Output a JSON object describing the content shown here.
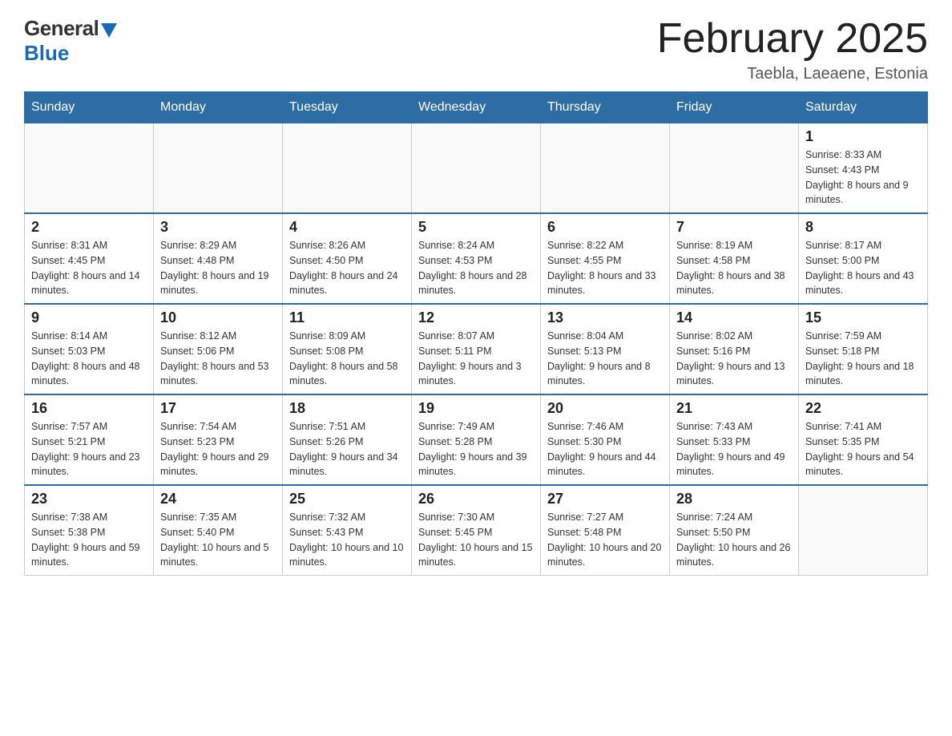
{
  "header": {
    "logo_general": "General",
    "logo_blue": "Blue",
    "month_title": "February 2025",
    "location": "Taebla, Laeaene, Estonia"
  },
  "weekdays": [
    "Sunday",
    "Monday",
    "Tuesday",
    "Wednesday",
    "Thursday",
    "Friday",
    "Saturday"
  ],
  "weeks": [
    [
      {
        "day": "",
        "info": ""
      },
      {
        "day": "",
        "info": ""
      },
      {
        "day": "",
        "info": ""
      },
      {
        "day": "",
        "info": ""
      },
      {
        "day": "",
        "info": ""
      },
      {
        "day": "",
        "info": ""
      },
      {
        "day": "1",
        "info": "Sunrise: 8:33 AM\nSunset: 4:43 PM\nDaylight: 8 hours and 9 minutes."
      }
    ],
    [
      {
        "day": "2",
        "info": "Sunrise: 8:31 AM\nSunset: 4:45 PM\nDaylight: 8 hours and 14 minutes."
      },
      {
        "day": "3",
        "info": "Sunrise: 8:29 AM\nSunset: 4:48 PM\nDaylight: 8 hours and 19 minutes."
      },
      {
        "day": "4",
        "info": "Sunrise: 8:26 AM\nSunset: 4:50 PM\nDaylight: 8 hours and 24 minutes."
      },
      {
        "day": "5",
        "info": "Sunrise: 8:24 AM\nSunset: 4:53 PM\nDaylight: 8 hours and 28 minutes."
      },
      {
        "day": "6",
        "info": "Sunrise: 8:22 AM\nSunset: 4:55 PM\nDaylight: 8 hours and 33 minutes."
      },
      {
        "day": "7",
        "info": "Sunrise: 8:19 AM\nSunset: 4:58 PM\nDaylight: 8 hours and 38 minutes."
      },
      {
        "day": "8",
        "info": "Sunrise: 8:17 AM\nSunset: 5:00 PM\nDaylight: 8 hours and 43 minutes."
      }
    ],
    [
      {
        "day": "9",
        "info": "Sunrise: 8:14 AM\nSunset: 5:03 PM\nDaylight: 8 hours and 48 minutes."
      },
      {
        "day": "10",
        "info": "Sunrise: 8:12 AM\nSunset: 5:06 PM\nDaylight: 8 hours and 53 minutes."
      },
      {
        "day": "11",
        "info": "Sunrise: 8:09 AM\nSunset: 5:08 PM\nDaylight: 8 hours and 58 minutes."
      },
      {
        "day": "12",
        "info": "Sunrise: 8:07 AM\nSunset: 5:11 PM\nDaylight: 9 hours and 3 minutes."
      },
      {
        "day": "13",
        "info": "Sunrise: 8:04 AM\nSunset: 5:13 PM\nDaylight: 9 hours and 8 minutes."
      },
      {
        "day": "14",
        "info": "Sunrise: 8:02 AM\nSunset: 5:16 PM\nDaylight: 9 hours and 13 minutes."
      },
      {
        "day": "15",
        "info": "Sunrise: 7:59 AM\nSunset: 5:18 PM\nDaylight: 9 hours and 18 minutes."
      }
    ],
    [
      {
        "day": "16",
        "info": "Sunrise: 7:57 AM\nSunset: 5:21 PM\nDaylight: 9 hours and 23 minutes."
      },
      {
        "day": "17",
        "info": "Sunrise: 7:54 AM\nSunset: 5:23 PM\nDaylight: 9 hours and 29 minutes."
      },
      {
        "day": "18",
        "info": "Sunrise: 7:51 AM\nSunset: 5:26 PM\nDaylight: 9 hours and 34 minutes."
      },
      {
        "day": "19",
        "info": "Sunrise: 7:49 AM\nSunset: 5:28 PM\nDaylight: 9 hours and 39 minutes."
      },
      {
        "day": "20",
        "info": "Sunrise: 7:46 AM\nSunset: 5:30 PM\nDaylight: 9 hours and 44 minutes."
      },
      {
        "day": "21",
        "info": "Sunrise: 7:43 AM\nSunset: 5:33 PM\nDaylight: 9 hours and 49 minutes."
      },
      {
        "day": "22",
        "info": "Sunrise: 7:41 AM\nSunset: 5:35 PM\nDaylight: 9 hours and 54 minutes."
      }
    ],
    [
      {
        "day": "23",
        "info": "Sunrise: 7:38 AM\nSunset: 5:38 PM\nDaylight: 9 hours and 59 minutes."
      },
      {
        "day": "24",
        "info": "Sunrise: 7:35 AM\nSunset: 5:40 PM\nDaylight: 10 hours and 5 minutes."
      },
      {
        "day": "25",
        "info": "Sunrise: 7:32 AM\nSunset: 5:43 PM\nDaylight: 10 hours and 10 minutes."
      },
      {
        "day": "26",
        "info": "Sunrise: 7:30 AM\nSunset: 5:45 PM\nDaylight: 10 hours and 15 minutes."
      },
      {
        "day": "27",
        "info": "Sunrise: 7:27 AM\nSunset: 5:48 PM\nDaylight: 10 hours and 20 minutes."
      },
      {
        "day": "28",
        "info": "Sunrise: 7:24 AM\nSunset: 5:50 PM\nDaylight: 10 hours and 26 minutes."
      },
      {
        "day": "",
        "info": ""
      }
    ]
  ]
}
